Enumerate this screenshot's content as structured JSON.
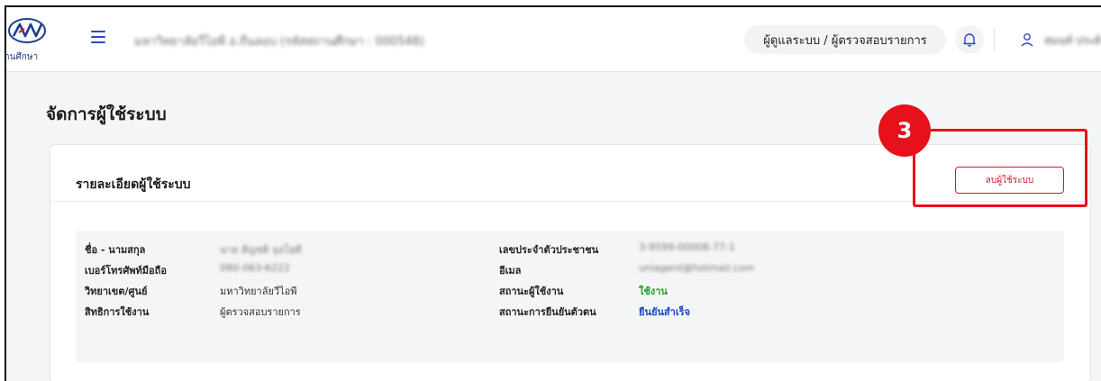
{
  "header": {
    "logo_caption": "านศึกษา",
    "org_name": "มหาวิทยาลัยวีไอพี อ.ถีนลอบ (รหัสสถานศึกษา : 000548)",
    "role": "ผู้ดูแลระบบ / ผู้ตรวจสอบรายการ",
    "user_name": "สมนท์ ประดิ"
  },
  "page": {
    "title": "จัดการผู้ใช้ระบบ"
  },
  "card": {
    "title": "รายละเอียดผู้ใช้ระบบ",
    "delete_label": "ลบผู้ใช้ระบบ"
  },
  "details": {
    "left": [
      {
        "label": "ชื่อ - นามสกุล",
        "value": "นาย สัญชติ จุลโฮดี"
      },
      {
        "label": "เบอร์โทรศัพท์มือถือ",
        "value": "080-063-6222"
      },
      {
        "label": "วิทยาเขต/ศูนย์",
        "value": "มหาวิทยาลัยวีไอพี"
      },
      {
        "label": "สิทธิการใช้งาน",
        "value": "ผู้ตรวจสอบรายการ"
      }
    ],
    "right": [
      {
        "label": "เลขประจำตัวประชาชน",
        "value": "3-9599-00008-77-1"
      },
      {
        "label": "อีเมล",
        "value": "uniagent@hotmail.com"
      },
      {
        "label": "สถานะผู้ใช้งาน",
        "value": "ใช้งาน"
      },
      {
        "label": "สถานะการยืนยันตัวตน",
        "value": "ยืนยันสำเร็จ"
      }
    ]
  },
  "annotation": {
    "step": "3"
  },
  "colors": {
    "accent": "#2c4bbf",
    "danger": "#d3182b",
    "annotation": "#e8101a",
    "status_active": "#2a9d2a",
    "status_verified": "#1a47c0"
  }
}
